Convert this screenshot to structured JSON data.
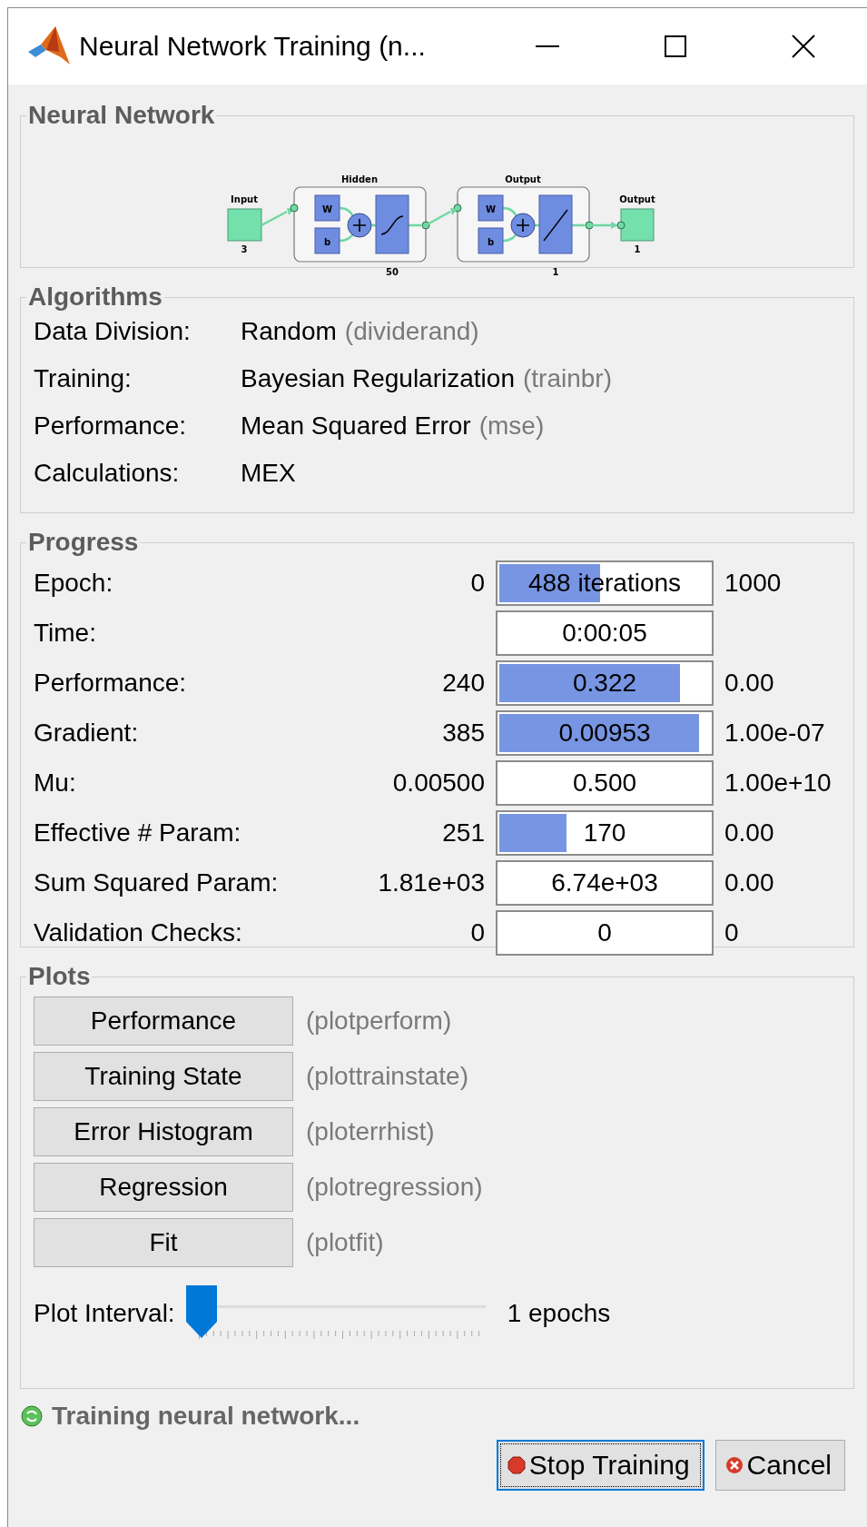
{
  "window": {
    "title": "Neural Network Training (n..."
  },
  "network": {
    "heading": "Neural Network",
    "input": {
      "label": "Input",
      "size": "3"
    },
    "layers": [
      {
        "label": "Hidden",
        "size": "50",
        "kind": "sigmoid",
        "weight": "W",
        "bias": "b"
      },
      {
        "label": "Output",
        "size": "1",
        "kind": "linear",
        "weight": "W",
        "bias": "b"
      }
    ],
    "output": {
      "label": "Output",
      "size": "1"
    }
  },
  "algorithms": {
    "heading": "Algorithms",
    "rows": [
      {
        "label": "Data Division:",
        "value": "Random",
        "hint": "(dividerand)"
      },
      {
        "label": "Training:",
        "value": "Bayesian Regularization",
        "hint": "(trainbr)"
      },
      {
        "label": "Performance:",
        "value": "Mean Squared Error",
        "hint": "(mse)"
      },
      {
        "label": "Calculations:",
        "value": "MEX"
      }
    ]
  },
  "progress": {
    "heading": "Progress",
    "rows": [
      {
        "label": "Epoch:",
        "start": "0",
        "value": "488 iterations",
        "level": 0.48,
        "end": "1000"
      },
      {
        "label": "Time:",
        "value": "0:00:05"
      },
      {
        "label": "Performance:",
        "start": "240",
        "value": "0.322",
        "level": 0.857,
        "end": "0.00"
      },
      {
        "label": "Gradient:",
        "start": "385",
        "value": "0.00953",
        "level": 0.948,
        "end": "1.00e-07"
      },
      {
        "label": "Mu:",
        "start": "0.00500",
        "value": "0.500",
        "end": "1.00e+10"
      },
      {
        "label": "Effective # Param:",
        "start": "251",
        "value": "170",
        "level": 0.317,
        "end": "0.00"
      },
      {
        "label": "Sum Squared Param:",
        "start": "1.81e+03",
        "value": "6.74e+03",
        "end": "0.00"
      },
      {
        "label": "Validation Checks:",
        "start": "0",
        "value": "0",
        "end": "0"
      }
    ]
  },
  "plots": {
    "heading": "Plots",
    "buttons": [
      {
        "label": "Performance",
        "function": "(plotperform)"
      },
      {
        "label": "Training State",
        "function": "(plottrainstate)"
      },
      {
        "label": "Error Histogram",
        "function": "(ploterrhist)"
      },
      {
        "label": "Regression",
        "function": "(plotregression)"
      },
      {
        "label": "Fit",
        "function": "(plotfit)"
      }
    ],
    "interval": {
      "label": "Plot Interval:",
      "level": 0,
      "reading": "1 epochs"
    }
  },
  "status": "Training neural network...",
  "buttons": [
    {
      "label": "Stop Training",
      "kind": "stop",
      "focused": true
    },
    {
      "label": "Cancel",
      "kind": "cancel",
      "focused": false
    }
  ]
}
